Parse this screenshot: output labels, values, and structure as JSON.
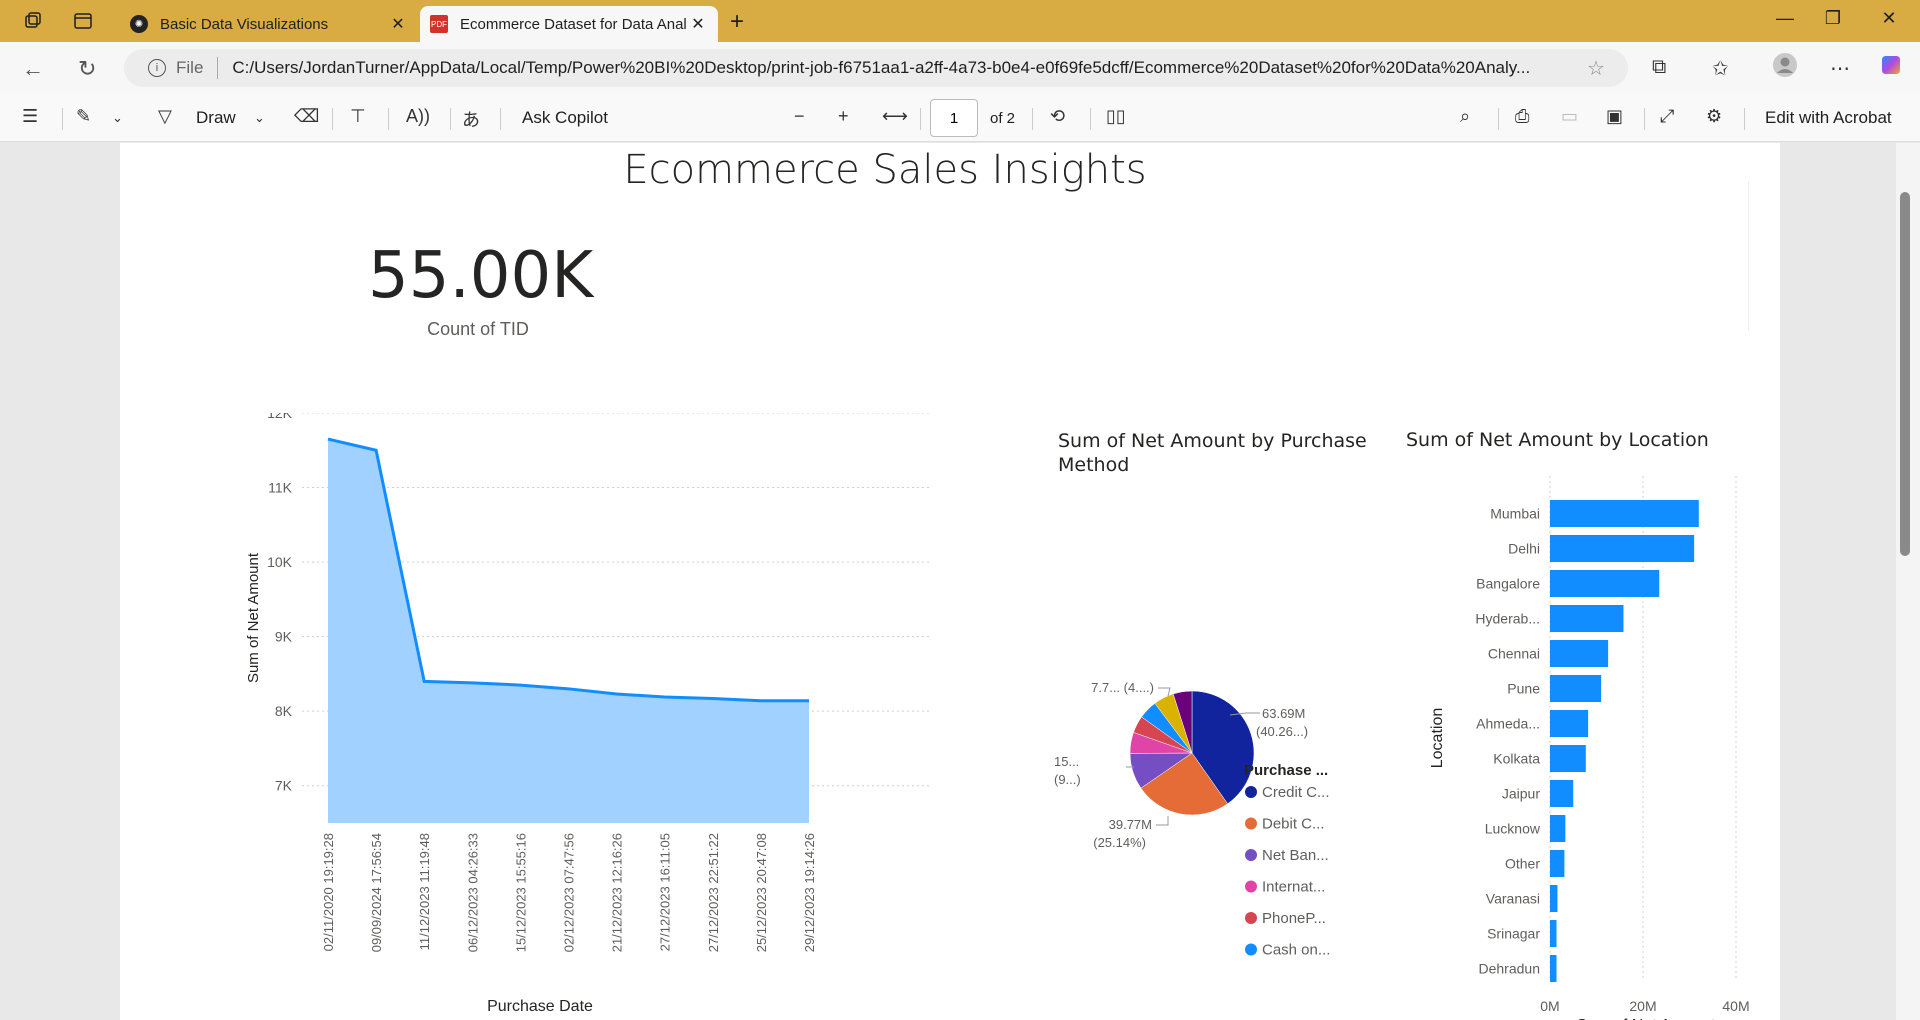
{
  "browser": {
    "tabs": [
      {
        "label": "Basic Data Visualizations"
      },
      {
        "label": "Ecommerce Dataset for Data Anal"
      }
    ],
    "address": {
      "scheme_label": "File",
      "url": "C:/Users/JordanTurner/AppData/Local/Temp/Power%20BI%20Desktop/print-job-f6751aa1-a2ff-4a73-b0e4-e0f69fe5dcff/Ecommerce%20Dataset%20for%20Data%20Analy..."
    }
  },
  "pdf_toolbar": {
    "draw_label": "Draw",
    "copilot_label": "Ask Copilot",
    "page_current": "1",
    "page_total": "of 2",
    "acrobat_label": "Edit with Acrobat"
  },
  "report": {
    "title": "Ecommerce Sales Insights",
    "kpi_value": "55.00K",
    "kpi_label": "Count of TID"
  },
  "colors": {
    "area_fill": "#a0d1ff",
    "line": "#118dff",
    "bar": "#118dff",
    "pie": [
      "#12239e",
      "#e66c37",
      "#6b007b",
      "#e044a7",
      "#d64550",
      "#118dff",
      "#d9b300",
      "#744ec2"
    ]
  },
  "chart_data": [
    {
      "type": "area",
      "xlabel": "Purchase Date",
      "ylabel": "Sum of Net Amount",
      "ylim": [
        6500,
        12000
      ],
      "yticks": [
        "12K",
        "11K",
        "10K",
        "9K",
        "8K",
        "7K"
      ],
      "ytick_values": [
        12000,
        11000,
        10000,
        9000,
        8000,
        7000
      ],
      "categories": [
        "02/11/2020 19:19:28",
        "09/09/2024 17:56:54",
        "11/12/2023 11:19:48",
        "06/12/2023 04:26:33",
        "15/12/2023 15:55:16",
        "02/12/2023 07:47:56",
        "21/12/2023 12:16:26",
        "27/12/2023 16:11:05",
        "27/12/2023 22:51:22",
        "25/12/2023 20:47:08",
        "29/12/2023 19:14:26"
      ],
      "values": [
        11650,
        11500,
        8400,
        8380,
        8350,
        8300,
        8230,
        8190,
        8170,
        8140,
        8140
      ],
      "grid": true
    },
    {
      "type": "pie",
      "title": "Sum of Net Amount by Purchase Method",
      "legend_title": "Purchase ...",
      "legend": [
        "Credit C...",
        "Debit C...",
        "Net Ban...",
        "Internat...",
        "PhoneP...",
        "Cash on...",
        "Paytm ...",
        "Google ..."
      ],
      "legend_colors": [
        "#12239e",
        "#e66c37",
        "#744ec2",
        "#e044a7",
        "#d64550",
        "#118dff",
        "#d9b300",
        "#6b007b"
      ],
      "slice_values": [
        40.26,
        25.14,
        9.5,
        5.5,
        4.5,
        4.9,
        5.3,
        4.9
      ],
      "slice_colors": [
        "#12239e",
        "#e66c37",
        "#744ec2",
        "#e044a7",
        "#d64550",
        "#118dff",
        "#d9b300",
        "#6b007b"
      ],
      "data_labels": [
        {
          "line1": "63.69M",
          "line2": "(40.26...)"
        },
        {
          "line1": "39.77M",
          "line2": "(25.14%)"
        },
        {
          "line1": "15...",
          "line2": "(9...)"
        },
        {
          "line1": "7.7... (4....)",
          "line2": ""
        }
      ]
    },
    {
      "type": "bar",
      "orientation": "horizontal",
      "title": "Sum of Net Amount by Location",
      "ylabel": "Location",
      "xlabel": "Sum of Net Amount",
      "xlim": [
        0,
        40
      ],
      "xticks": [
        "0M",
        "20M",
        "40M"
      ],
      "xtick_values": [
        0,
        20,
        40
      ],
      "categories": [
        "Mumbai",
        "Delhi",
        "Bangalore",
        "Hyderab...",
        "Chennai",
        "Pune",
        "Ahmeda...",
        "Kolkata",
        "Jaipur",
        "Lucknow",
        "Other",
        "Varanasi",
        "Srinagar",
        "Dehradun"
      ],
      "values": [
        32,
        31,
        23.5,
        15.8,
        12.5,
        11,
        8.2,
        7.7,
        5,
        3.3,
        3.1,
        1.6,
        1.4,
        1.4
      ],
      "grid": true
    }
  ]
}
